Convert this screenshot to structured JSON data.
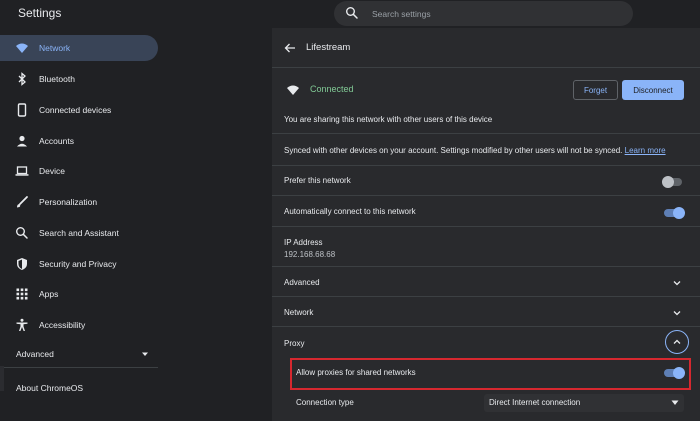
{
  "header": {
    "title": "Settings",
    "search_placeholder": "Search settings"
  },
  "sidebar": {
    "items": [
      {
        "label": "Network",
        "icon": "wifi-icon",
        "active": true
      },
      {
        "label": "Bluetooth",
        "icon": "bluetooth-icon"
      },
      {
        "label": "Connected devices",
        "icon": "phone-icon"
      },
      {
        "label": "Accounts",
        "icon": "person-icon"
      },
      {
        "label": "Device",
        "icon": "laptop-icon"
      },
      {
        "label": "Personalization",
        "icon": "brush-icon"
      },
      {
        "label": "Search and Assistant",
        "icon": "search-icon"
      },
      {
        "label": "Security and Privacy",
        "icon": "shield-icon"
      },
      {
        "label": "Apps",
        "icon": "grid-icon"
      },
      {
        "label": "Accessibility",
        "icon": "accessibility-icon"
      }
    ],
    "advanced_label": "Advanced",
    "about_label": "About ChromeOS"
  },
  "network": {
    "title": "Lifestream",
    "status": "Connected",
    "forget_label": "Forget",
    "disconnect_label": "Disconnect",
    "sharing_text": "You are sharing this network with other users of this device",
    "synced_text": "Synced with other devices on your account. Settings modified by other users will not be synced.",
    "learn_more": "Learn more",
    "prefer_label": "Prefer this network",
    "prefer_on": false,
    "auto_connect_label": "Automatically connect to this network",
    "auto_connect_on": true,
    "ip_label": "IP Address",
    "ip_value": "192.168.68.68",
    "advanced_label": "Advanced",
    "network_label": "Network",
    "proxy_label": "Proxy",
    "allow_proxies_label": "Allow proxies for shared networks",
    "allow_proxies_on": true,
    "connection_type_label": "Connection type",
    "connection_type_value": "Direct Internet connection"
  },
  "colors": {
    "accent": "#8ab4f8",
    "connected": "#81c995",
    "highlight": "#d6282f"
  }
}
